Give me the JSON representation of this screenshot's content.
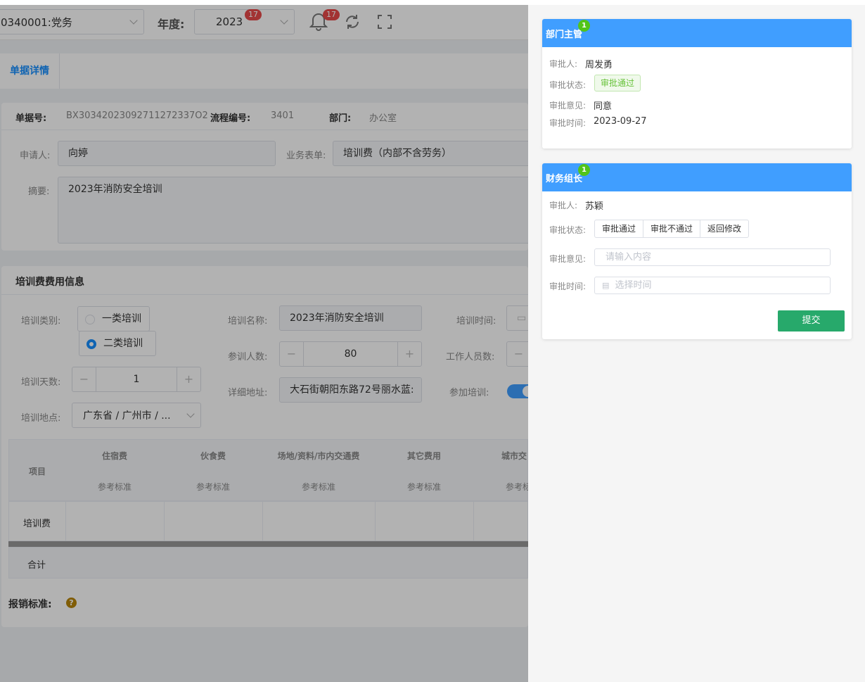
{
  "topbar": {
    "org_select": "0340001:党务",
    "year_label": "年度:",
    "year_value": "2023",
    "year_badge": "17",
    "bell_badge": "17"
  },
  "tabs": {
    "active": "单据详情"
  },
  "header": {
    "doc_no_label": "单据号:",
    "doc_no": "BX30342023092711272337O2",
    "flow_no_label": "流程编号:",
    "flow_no": "3401",
    "dept_label": "部门:",
    "dept": "办公室"
  },
  "applicant": {
    "label": "申请人:",
    "value": "向婷",
    "form_label": "业务表单:",
    "form_value": "培训费（内部不含劳务）",
    "summary_label": "摘要:",
    "summary_value": "2023年消防安全培训"
  },
  "training": {
    "section_title": "培训费费用信息",
    "type_label": "培训类别:",
    "type_options": [
      "一类培训",
      "二类培训"
    ],
    "type_selected": "二类培训",
    "name_label": "培训名称:",
    "name_value": "2023年消防安全培训",
    "time_label": "培训时间:",
    "participants_label": "参训人数:",
    "participants_value": "80",
    "staff_label": "工作人员数:",
    "days_label": "培训天数:",
    "days_value": "1",
    "address_label": "详细地址:",
    "address_value": "大石街朝阳东路72号丽水蓝:",
    "attend_label": "参加培训:",
    "location_label": "培训地点:",
    "location_value": "广东省 / 广州市 / ..."
  },
  "table": {
    "item_header": "项目",
    "columns": [
      "住宿费",
      "伙食费",
      "场地/资料/市内交通费",
      "其它费用",
      "城市交"
    ],
    "sub_header": "参考标准",
    "row_label": "培训费",
    "total_label": "合计"
  },
  "reimburse": {
    "label": "报销标准:"
  },
  "approvals": [
    {
      "title": "部门主管",
      "badge": "1",
      "approver_label": "审批人:",
      "approver": "周发勇",
      "status_label": "审批状态:",
      "status": "审批通过",
      "opinion_label": "审批意见:",
      "opinion": "同意",
      "time_label": "审批时间:",
      "time": "2023-09-27"
    },
    {
      "title": "财务组长",
      "badge": "1",
      "approver_label": "审批人:",
      "approver": "苏颖",
      "status_label": "审批状态:",
      "status_options": [
        "审批通过",
        "审批不通过",
        "返回修改"
      ],
      "opinion_label": "审批意见:",
      "opinion_placeholder": "请输入内容",
      "time_label": "审批时间:",
      "time_placeholder": "选择时间",
      "submit_label": "提交"
    }
  ]
}
